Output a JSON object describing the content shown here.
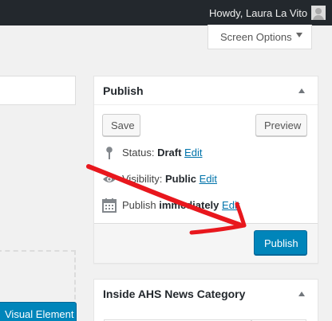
{
  "adminbar": {
    "greeting": "Howdy, Laura La Vito",
    "background_color": "#23282d",
    "avatar_icon": "user-avatar-placeholder"
  },
  "screen_options": {
    "label": "Screen Options",
    "icon": "triangle-down-icon"
  },
  "editor": {
    "visual_element_label": "Visual Element",
    "accent_color": "#0085ba"
  },
  "publish_box": {
    "title": "Publish",
    "save_label": "Save",
    "preview_label": "Preview",
    "status": {
      "icon": "pin-icon",
      "label": "Status: ",
      "value": "Draft",
      "edit_label": "Edit"
    },
    "visibility": {
      "icon": "eye-icon",
      "label": "Visibility: ",
      "value": "Public",
      "edit_label": "Edit"
    },
    "schedule": {
      "icon": "calendar-icon",
      "label": "Publish ",
      "value": "immediately",
      "edit_label": "Edit"
    },
    "publish_label": "Publish",
    "publish_color": "#0085ba"
  },
  "category_box": {
    "title": "Inside AHS News Category"
  },
  "annotation": {
    "type": "hand-drawn-arrow",
    "color": "#e8171d"
  }
}
